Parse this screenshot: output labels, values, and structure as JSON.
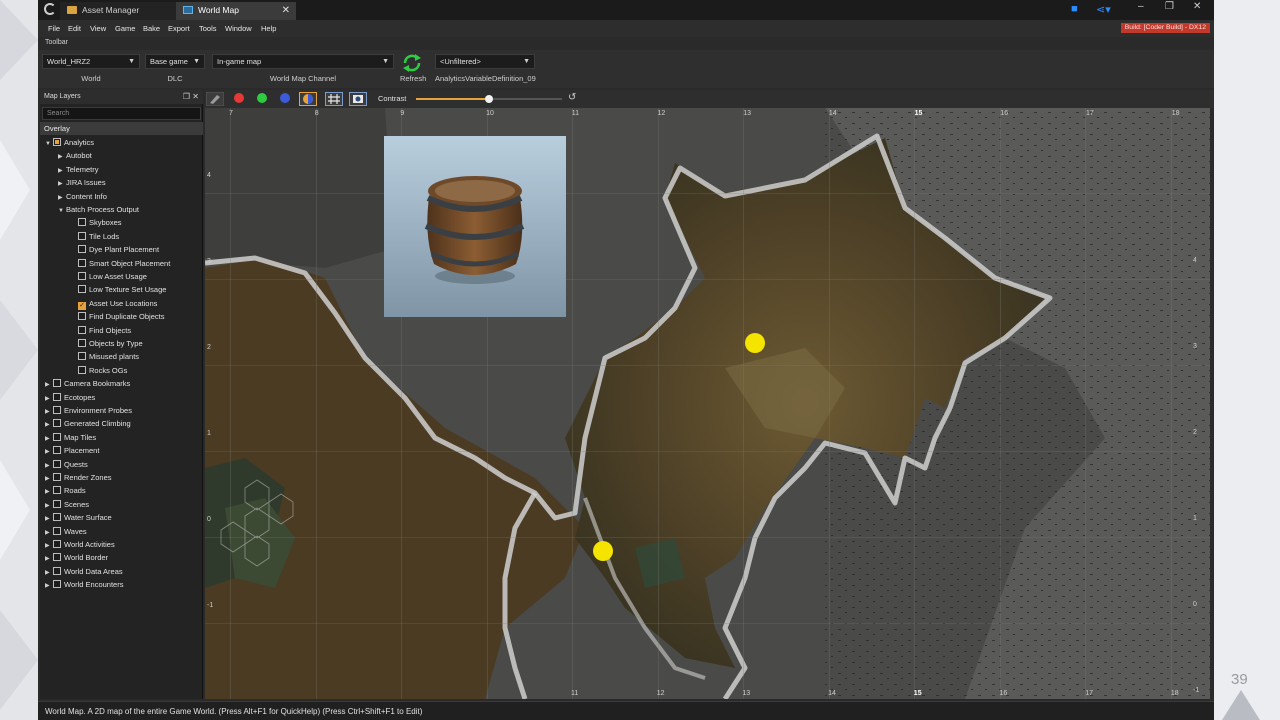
{
  "slide": {
    "page_number": "39"
  },
  "titlebar": {
    "tabs": [
      {
        "label": "Asset Manager",
        "icon": "folder-icon"
      },
      {
        "label": "World Map",
        "icon": "map-icon",
        "active": true
      }
    ],
    "close_glyph": "✕",
    "window_controls": [
      "–",
      "❐",
      "✕"
    ]
  },
  "menu": {
    "items": [
      "File",
      "Edit",
      "View",
      "Game",
      "Bake",
      "Export",
      "Tools",
      "Window",
      "Help"
    ],
    "build_badge": "Build: [Coder Build] - DX12"
  },
  "toolbar": {
    "label": "Toolbar",
    "world": {
      "value": "World_HRZ2",
      "caption": "World"
    },
    "dlc": {
      "value": "Base game",
      "caption": "DLC"
    },
    "channel": {
      "value": "In-game map",
      "caption": "World Map Channel"
    },
    "refresh_label": "Refresh",
    "filter": {
      "value": "<Unfiltered>",
      "caption": "AnalyticsVariableDefinition_09"
    }
  },
  "layers_panel": {
    "title": "Map Layers",
    "search_placeholder": "Search",
    "overlay_label": "Overlay",
    "tree": [
      {
        "label": "Analytics",
        "level": 0,
        "expanded": true,
        "check": "partial"
      },
      {
        "label": "Autobot",
        "level": 1,
        "expanded": false
      },
      {
        "label": "Telemetry",
        "level": 1,
        "expanded": false
      },
      {
        "label": "JIRA Issues",
        "level": 1,
        "expanded": false
      },
      {
        "label": "Content Info",
        "level": 1,
        "expanded": false
      },
      {
        "label": "Batch Process Output",
        "level": 1,
        "expanded": true
      },
      {
        "label": "Skyboxes",
        "level": 2,
        "check": "off"
      },
      {
        "label": "Tile Lods",
        "level": 2,
        "check": "off"
      },
      {
        "label": "Dye Plant Placement",
        "level": 2,
        "check": "off"
      },
      {
        "label": "Smart Object Placement",
        "level": 2,
        "check": "off"
      },
      {
        "label": "Low Asset Usage",
        "level": 2,
        "check": "off"
      },
      {
        "label": "Low Texture Set Usage",
        "level": 2,
        "check": "off"
      },
      {
        "label": "Asset Use Locations",
        "level": 2,
        "check": "on"
      },
      {
        "label": "Find Duplicate Objects",
        "level": 2,
        "check": "off"
      },
      {
        "label": "Find Objects",
        "level": 2,
        "check": "off"
      },
      {
        "label": "Objects by Type",
        "level": 2,
        "check": "off"
      },
      {
        "label": "Misused plants",
        "level": 2,
        "check": "off"
      },
      {
        "label": "Rocks OGs",
        "level": 2,
        "check": "off"
      },
      {
        "label": "Camera Bookmarks",
        "level": 0,
        "expanded": false,
        "check": "off"
      },
      {
        "label": "Ecotopes",
        "level": 0,
        "expanded": false,
        "check": "off"
      },
      {
        "label": "Environment Probes",
        "level": 0,
        "expanded": false,
        "check": "off"
      },
      {
        "label": "Generated Climbing",
        "level": 0,
        "expanded": false,
        "check": "off"
      },
      {
        "label": "Map Tiles",
        "level": 0,
        "expanded": false,
        "check": "off"
      },
      {
        "label": "Placement",
        "level": 0,
        "expanded": false,
        "check": "off"
      },
      {
        "label": "Quests",
        "level": 0,
        "expanded": false,
        "check": "off"
      },
      {
        "label": "Render Zones",
        "level": 0,
        "expanded": false,
        "check": "off"
      },
      {
        "label": "Roads",
        "level": 0,
        "expanded": false,
        "check": "off"
      },
      {
        "label": "Scenes",
        "level": 0,
        "expanded": false,
        "check": "off"
      },
      {
        "label": "Water Surface",
        "level": 0,
        "expanded": false,
        "check": "off"
      },
      {
        "label": "Waves",
        "level": 0,
        "expanded": false,
        "check": "off"
      },
      {
        "label": "World Activities",
        "level": 0,
        "expanded": false,
        "check": "off"
      },
      {
        "label": "World Border",
        "level": 0,
        "expanded": false,
        "check": "off"
      },
      {
        "label": "World Data Areas",
        "level": 0,
        "expanded": false,
        "check": "off"
      },
      {
        "label": "World Encounters",
        "level": 0,
        "expanded": false,
        "check": "off"
      }
    ]
  },
  "map_toolbar": {
    "channel_dots": [
      "#e53935",
      "#2ecc40",
      "#3b5bdb"
    ],
    "contrast_label": "Contrast",
    "contrast_value": 0.5
  },
  "map": {
    "top_labels": [
      "7",
      "8",
      "9",
      "10",
      "11",
      "12",
      "13",
      "14",
      "15",
      "16",
      "17",
      "18"
    ],
    "bottom_labels": [
      "11",
      "12",
      "13",
      "14",
      "15",
      "16",
      "17",
      "18"
    ],
    "left_labels": [
      "4",
      "3",
      "2",
      "1",
      "0",
      "-1"
    ],
    "right_labels": [
      "4",
      "3",
      "2",
      "1",
      "0",
      "-1"
    ],
    "emphasized_label": "15",
    "marker_color": "#f5e300"
  },
  "status": {
    "text": "World Map. A 2D map of the entire Game World. (Press Alt+F1 for QuickHelp) (Press Ctrl+Shift+F1 to Edit)"
  }
}
